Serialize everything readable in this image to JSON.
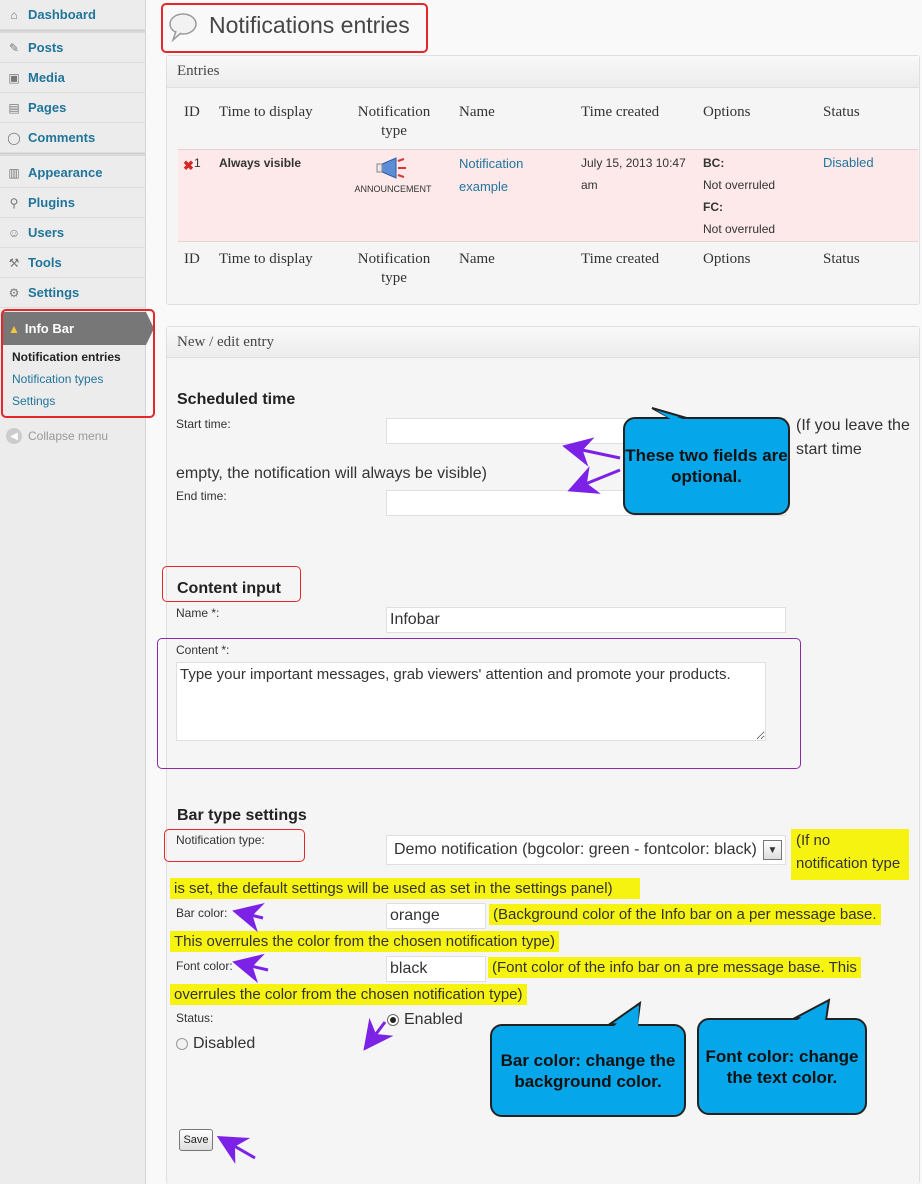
{
  "sidebar": {
    "items": [
      {
        "label": "Dashboard",
        "icon": "dashboard-icon"
      },
      {
        "label": "Posts",
        "icon": "pin-icon"
      },
      {
        "label": "Media",
        "icon": "media-icon"
      },
      {
        "label": "Pages",
        "icon": "pages-icon"
      },
      {
        "label": "Comments",
        "icon": "comments-icon"
      },
      {
        "label": "Appearance",
        "icon": "appearance-icon"
      },
      {
        "label": "Plugins",
        "icon": "plugin-icon"
      },
      {
        "label": "Users",
        "icon": "users-icon"
      },
      {
        "label": "Tools",
        "icon": "tools-icon"
      },
      {
        "label": "Settings",
        "icon": "settings-icon"
      }
    ],
    "plugin_menu": "Info Bar",
    "submenu": [
      "Notification entries",
      "Notification types",
      "Settings"
    ],
    "collapse": "Collapse menu"
  },
  "page": {
    "title": "Notifications entries"
  },
  "entries": {
    "header": "Entries",
    "columns": [
      "ID",
      "Time to display",
      "Notification type",
      "Name",
      "Time created",
      "Options",
      "Status"
    ],
    "row": {
      "id": "1",
      "time_to_display": "Always visible",
      "type_caption": "ANNOUNCEMENT",
      "name": "Notification example",
      "time_created": "July 15, 2013 10:47 am",
      "bc_label": "BC:",
      "bc_value": "Not overruled",
      "fc_label": "FC:",
      "fc_value": "Not overruled",
      "status": "Disabled"
    }
  },
  "form": {
    "header": "New / edit entry",
    "scheduled": {
      "title": "Scheduled time",
      "start_label": "Start time:",
      "end_label": "End time:",
      "hint_a": "(If you leave the",
      "hint_b": "start time",
      "hint_c": "empty, the notification will always be visible)"
    },
    "content": {
      "title": "Content input",
      "name_label": "Name *:",
      "name_value": "Infobar",
      "content_label": "Content *:",
      "content_value": "Type your important messages, grab viewers' attention and promote your products."
    },
    "bar": {
      "title": "Bar type settings",
      "type_label": "Notification type:",
      "type_value": "Demo notification (bgcolor: green - fontcolor: black)",
      "type_hint_a": "(If no",
      "type_hint_b": "notification type",
      "type_hint_c": "is set, the default settings will be used as set in the settings panel)",
      "barcolor_label": "Bar color:",
      "barcolor_value": "orange",
      "barcolor_hint_a": "(Background color of the Info bar on a per message base.",
      "barcolor_hint_b": "This overrules the color from the chosen notification type)",
      "fontcolor_label": "Font color:",
      "fontcolor_value": "black",
      "fontcolor_hint_a": "(Font color of the info bar on a pre message base. This",
      "fontcolor_hint_b": "overrules the color from the chosen notification type)",
      "status_label": "Status:",
      "status_enabled": "Enabled",
      "status_disabled": "Disabled",
      "status_selected": "Enabled"
    },
    "save_label": "Save"
  },
  "callouts": {
    "optional": "These two fields are optional.",
    "barcolor": "Bar color: change the background color.",
    "fontcolor": "Font color: change the text color."
  },
  "colors": {
    "link": "#21759b",
    "highlight": "#f7f311",
    "callout": "#05a7ea",
    "annotation_red": "#e5262b",
    "arrow": "#7b22e6",
    "row_bg": "#fde9e9"
  }
}
